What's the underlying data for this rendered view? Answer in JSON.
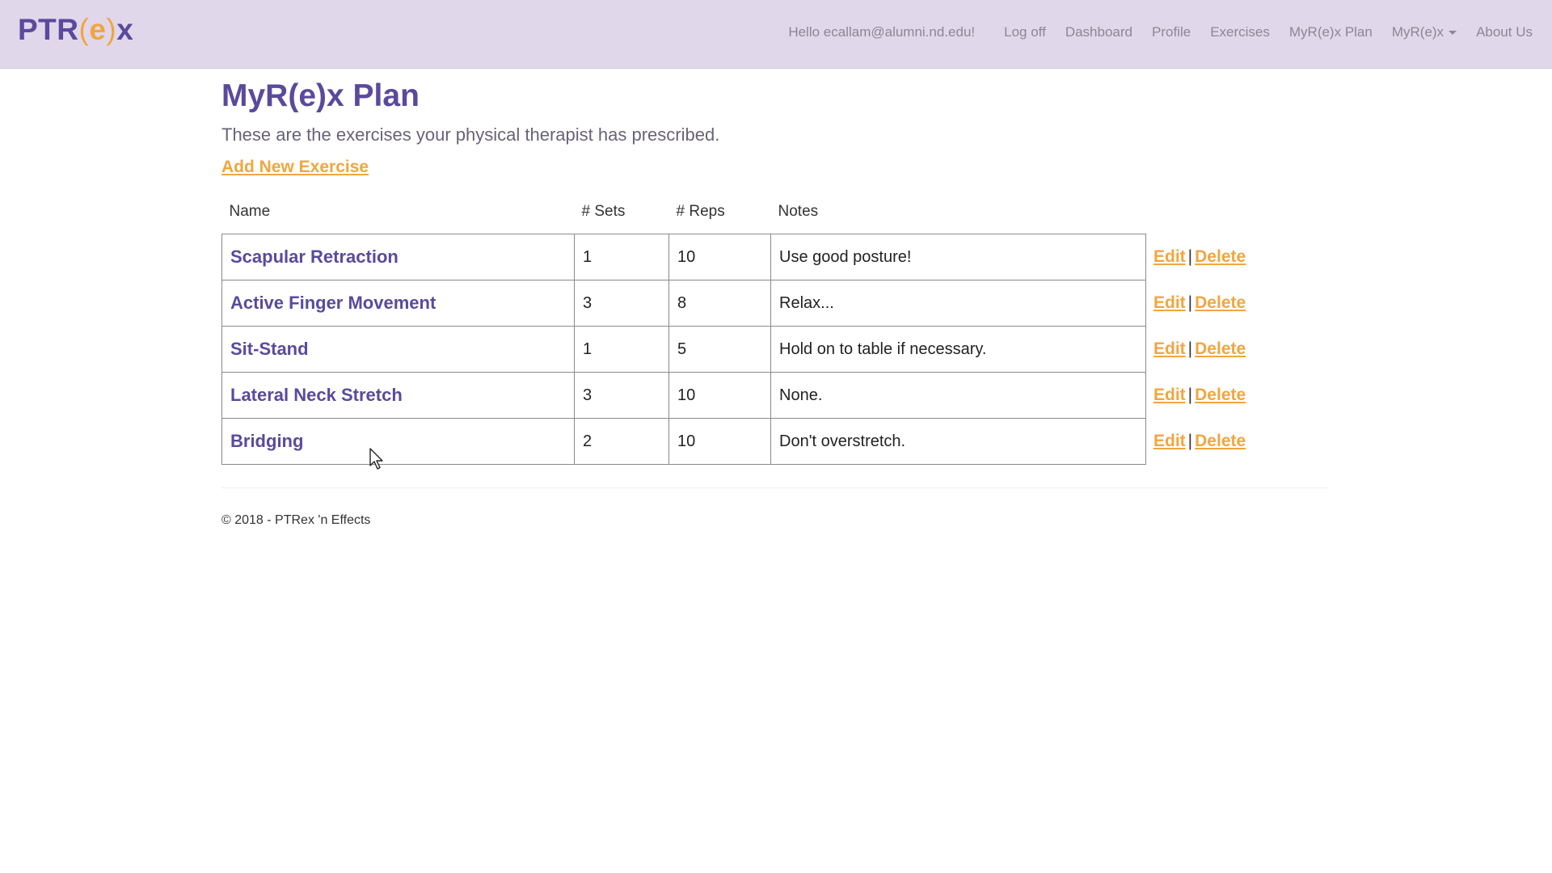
{
  "brand": {
    "prefix": "PTR",
    "open_paren": "(",
    "letter": "e",
    "close_paren": ")",
    "suffix": "x"
  },
  "nav": {
    "greeting": "Hello ecallam@alumni.nd.edu!",
    "logoff": "Log off",
    "dashboard": "Dashboard",
    "profile": "Profile",
    "exercises": "Exercises",
    "plan": "MyR(e)x Plan",
    "myrex": "MyR(e)x",
    "about": "About Us"
  },
  "page": {
    "title": "MyR(e)x Plan",
    "subtitle": "These are the exercises your physical therapist has prescribed.",
    "add_link": "Add New Exercise"
  },
  "table": {
    "headers": {
      "name": "Name",
      "sets": "# Sets",
      "reps": "# Reps",
      "notes": "Notes"
    },
    "rows": [
      {
        "name": "Scapular Retraction",
        "sets": "1",
        "reps": "10",
        "notes": "Use good posture!"
      },
      {
        "name": "Active Finger Movement",
        "sets": "3",
        "reps": "8",
        "notes": "Relax..."
      },
      {
        "name": "Sit-Stand",
        "sets": "1",
        "reps": "5",
        "notes": "Hold on to table if necessary."
      },
      {
        "name": "Lateral Neck Stretch",
        "sets": "3",
        "reps": "10",
        "notes": "None."
      },
      {
        "name": "Bridging",
        "sets": "2",
        "reps": "10",
        "notes": "Don't overstretch."
      }
    ],
    "edit_label": "Edit",
    "separator": "|",
    "delete_label": "Delete"
  },
  "footer": {
    "text": "© 2018 - PTRex 'n Effects"
  },
  "colors": {
    "navbar_bg": "#e1d7ea",
    "brand_purple": "#5a4a9c",
    "accent_orange": "#f0a640"
  },
  "icons": {
    "dropdown": "caret-down-icon",
    "pointer": "mouse-cursor-icon"
  }
}
